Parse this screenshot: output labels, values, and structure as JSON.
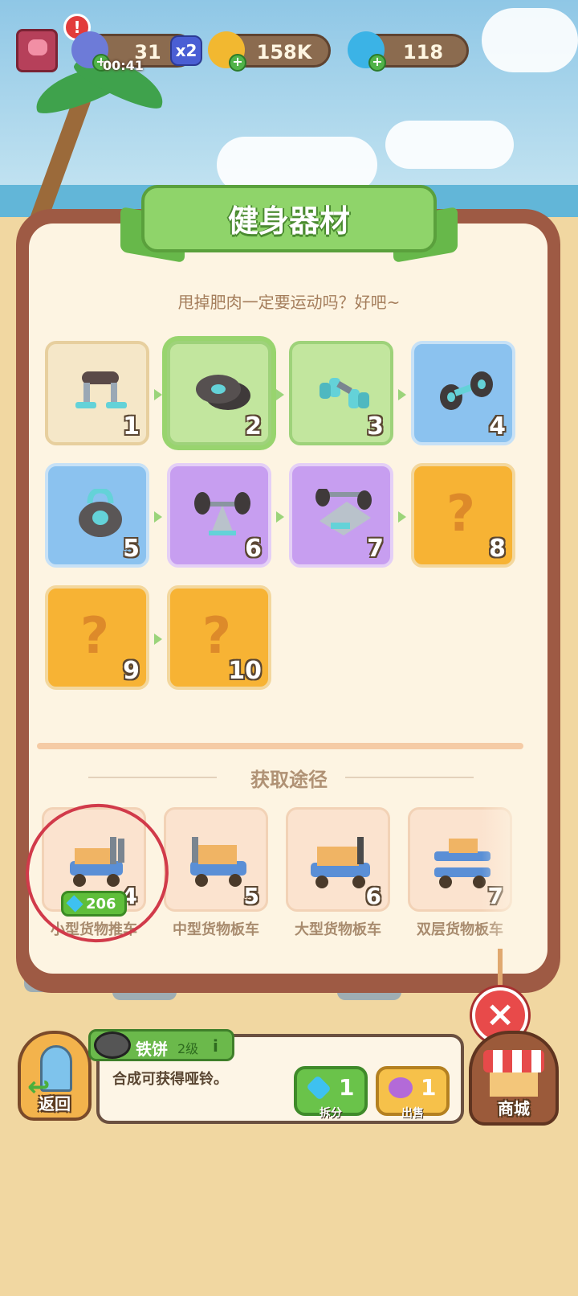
{
  "top_bar": {
    "energy": "31",
    "energy_multiplier": "x2",
    "energy_timer": "00:41",
    "coins": "158K",
    "gems": "118"
  },
  "panel": {
    "title": "健身器材",
    "subtitle": "甩掉肥肉一定要运动吗？好吧~",
    "items": [
      {
        "level": "1",
        "state": "unlocked",
        "tint": "cream"
      },
      {
        "level": "2",
        "state": "selected",
        "tint": "green"
      },
      {
        "level": "3",
        "state": "unlocked",
        "tint": "green"
      },
      {
        "level": "4",
        "state": "unlocked",
        "tint": "blue"
      },
      {
        "level": "5",
        "state": "unlocked",
        "tint": "blue"
      },
      {
        "level": "6",
        "state": "unlocked",
        "tint": "purple"
      },
      {
        "level": "7",
        "state": "unlocked",
        "tint": "purple"
      },
      {
        "level": "8",
        "state": "locked",
        "tint": "orange"
      },
      {
        "level": "9",
        "state": "locked",
        "tint": "orange"
      },
      {
        "level": "10",
        "state": "locked",
        "tint": "orange"
      }
    ],
    "locked_mark": "?",
    "sources_title": "获取途径",
    "sources": [
      {
        "level": "4",
        "name": "小型货物推车",
        "price": "206"
      },
      {
        "level": "5",
        "name": "中型货物板车"
      },
      {
        "level": "6",
        "name": "大型货物板车"
      },
      {
        "level": "7",
        "name": "双层货物板车"
      }
    ]
  },
  "close_button": "×",
  "bottom": {
    "back_label": "返回",
    "item_name": "铁饼",
    "item_level": "2级",
    "info_icon": "i",
    "description": "合成可获得哑铃。",
    "split_amount": "1",
    "split_label": "拆分",
    "sell_amount": "1",
    "sell_label": "出售",
    "shop_label": "商城"
  }
}
